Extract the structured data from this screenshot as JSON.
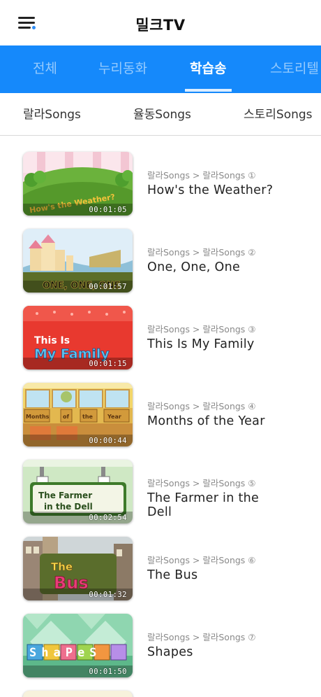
{
  "header": {
    "title": "밀크TV",
    "menu_icon": "hamburger-menu-icon"
  },
  "tabs": [
    {
      "label": "전체",
      "active": false
    },
    {
      "label": "누리동화",
      "active": false
    },
    {
      "label": "학습송",
      "active": true
    },
    {
      "label": "스토리텔",
      "active": false
    }
  ],
  "subtabs": [
    {
      "label": "랄라Songs"
    },
    {
      "label": "율동Songs"
    },
    {
      "label": "스토리Songs"
    }
  ],
  "videos": [
    {
      "breadcrumb": "랄라Songs > 랄라Songs ①",
      "title": "How's the Weather?",
      "duration": "00:01:05",
      "thumb_text": "How's the Weather?"
    },
    {
      "breadcrumb": "랄라Songs > 랄라Songs ②",
      "title": "One, One, One",
      "duration": "00:01:57",
      "thumb_text": "ONE, ONE, ONE"
    },
    {
      "breadcrumb": "랄라Songs > 랄라Songs ③",
      "title": "This Is My Family",
      "duration": "00:01:15",
      "thumb_text_1": "This Is",
      "thumb_text_2": "My Family"
    },
    {
      "breadcrumb": "랄라Songs > 랄라Songs ④",
      "title": "Months of the Year",
      "duration": "00:00:44",
      "thumb_text_1": "Months",
      "thumb_text_2": "of",
      "thumb_text_3": "the",
      "thumb_text_4": "Year"
    },
    {
      "breadcrumb": "랄라Songs > 랄라Songs ⑤",
      "title": "The Farmer in the Dell",
      "duration": "00:02:54",
      "thumb_text_1": "The Farmer",
      "thumb_text_2": "in the Dell"
    },
    {
      "breadcrumb": "랄라Songs > 랄라Songs ⑥",
      "title": "The Bus",
      "duration": "00:01:32",
      "thumb_text_1": "The",
      "thumb_text_2": "Bus"
    },
    {
      "breadcrumb": "랄라Songs > 랄라Songs ⑦",
      "title": "Shapes",
      "duration": "00:01:50",
      "thumb_text": "ShaPeS"
    }
  ],
  "colors": {
    "accent": "#1589fb",
    "tab_inactive": "rgba(255,255,255,0.55)",
    "breadcrumb": "#8a8a8a"
  }
}
